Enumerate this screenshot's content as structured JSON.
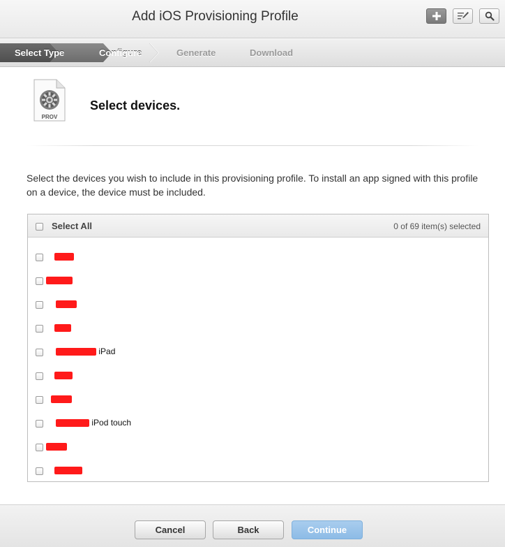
{
  "window": {
    "title": "Add iOS Provisioning Profile"
  },
  "toolbar": {
    "add_icon": "plus-icon",
    "edit_icon": "edit-icon",
    "search_icon": "search-icon"
  },
  "steps": [
    {
      "label": "Select Type",
      "state": "completed"
    },
    {
      "label": "Configure",
      "state": "active"
    },
    {
      "label": "Generate",
      "state": "pending"
    },
    {
      "label": "Download",
      "state": "pending"
    }
  ],
  "header": {
    "icon_label": "PROV",
    "heading": "Select devices."
  },
  "instructions": "Select the devices you wish to include in this provisioning profile. To install an app signed with this profile on a device, the device must be included.",
  "device_table": {
    "select_all_label": "Select All",
    "selection_count": "0 of 69 item(s) selected",
    "rows": [
      {
        "suffix": ""
      },
      {
        "suffix": ""
      },
      {
        "suffix": ""
      },
      {
        "suffix": ""
      },
      {
        "suffix": "iPad"
      },
      {
        "suffix": ""
      },
      {
        "suffix": ""
      },
      {
        "suffix": "iPod touch"
      },
      {
        "suffix": ""
      },
      {
        "suffix": ""
      }
    ]
  },
  "footer": {
    "cancel_label": "Cancel",
    "back_label": "Back",
    "continue_label": "Continue"
  },
  "colors": {
    "step_active_bg": "#6f6f6f",
    "step_completed_bg": "#5a5a5a",
    "continue_button": "#9cc5ec",
    "redaction": "#ff1a1a"
  }
}
